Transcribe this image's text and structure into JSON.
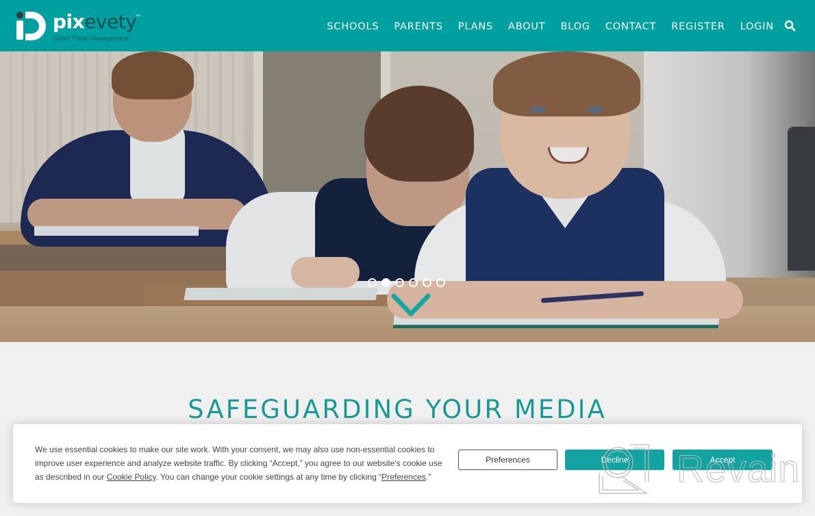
{
  "header": {
    "brand": {
      "name_part1": "pix",
      "name_part2": "evety",
      "trademark": "™",
      "tagline": "Smart Photo Management"
    },
    "nav": [
      {
        "label": "SCHOOLS"
      },
      {
        "label": "PARENTS"
      },
      {
        "label": "PLANS"
      },
      {
        "label": "ABOUT"
      },
      {
        "label": "BLOG"
      },
      {
        "label": "CONTACT"
      },
      {
        "label": "REGISTER"
      },
      {
        "label": "LOGIN"
      }
    ],
    "search_icon": "search-icon"
  },
  "hero": {
    "image_description": "Three schoolboys in navy uniforms writing at classroom desks; the front boy is smiling at the camera",
    "slides": {
      "count": 6,
      "active_index": 1
    },
    "scroll_icon": "chevron-down-icon"
  },
  "section": {
    "title": "SAFEGUARDING YOUR MEDIA"
  },
  "cookie_banner": {
    "text_part1": "We use essential cookies to make our site work. With your consent, we may also use non-essential cookies to improve user experience and analyze website traffic. By clicking “Accept,” you agree to our website's cookie use as described in our ",
    "cookie_policy_link": "Cookie Policy",
    "text_part2": ". You can change your cookie settings at any time by clicking “",
    "preferences_link": "Preferences",
    "text_part3": ".”",
    "buttons": {
      "preferences": "Preferences",
      "decline": "Decline",
      "accept": "Accept"
    }
  },
  "watermark": {
    "text": "Revain"
  },
  "colors": {
    "brand_teal": "#00a0a0",
    "title_teal": "#1a9a96",
    "button_teal": "#13a3a0",
    "logo_dark": "#1f4f55"
  }
}
